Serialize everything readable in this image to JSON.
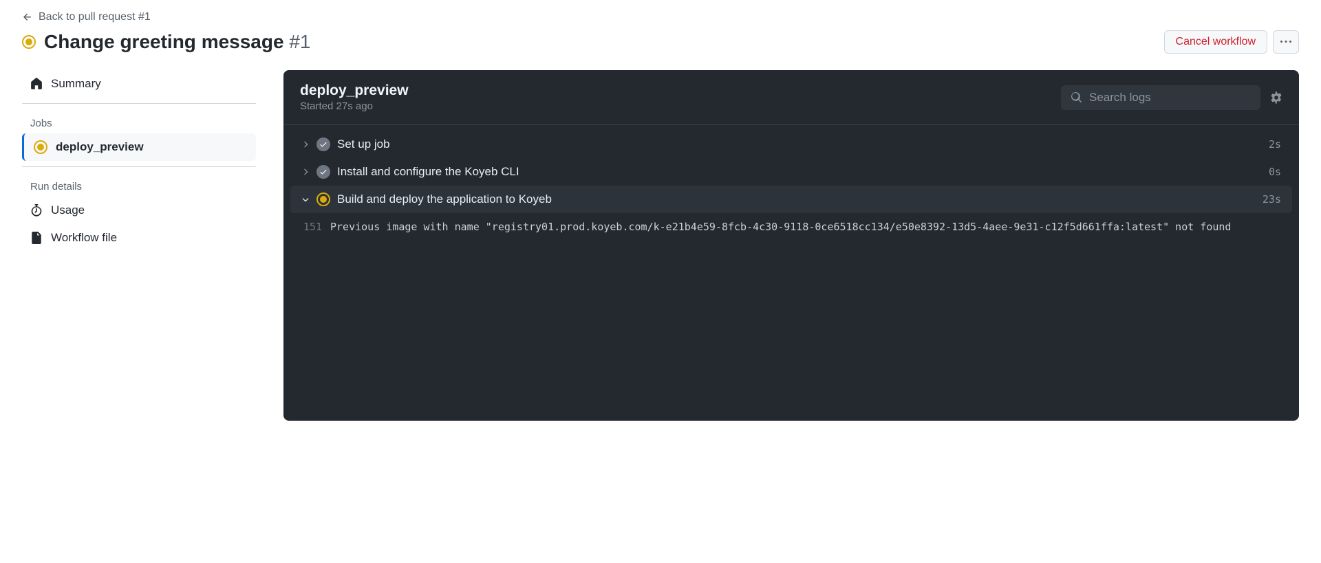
{
  "back_link": "Back to pull request #1",
  "title": "Change greeting message",
  "title_num": "#1",
  "actions": {
    "cancel": "Cancel workflow"
  },
  "sidebar": {
    "summary": "Summary",
    "jobs_label": "Jobs",
    "job_name": "deploy_preview",
    "run_details_label": "Run details",
    "usage": "Usage",
    "workflow_file": "Workflow file"
  },
  "main": {
    "title": "deploy_preview",
    "started": "Started 27s ago",
    "search_placeholder": "Search logs"
  },
  "steps": [
    {
      "name": "Set up job",
      "time": "2s",
      "status": "done",
      "expanded": false
    },
    {
      "name": "Install and configure the Koyeb CLI",
      "time": "0s",
      "status": "done",
      "expanded": false
    },
    {
      "name": "Build and deploy the application to Koyeb",
      "time": "23s",
      "status": "running",
      "expanded": true
    }
  ],
  "logs": [
    {
      "n": "151",
      "t": "Previous image with name \"registry01.prod.koyeb.com/k-e21b4e59-8fcb-4c30-9118-0ce6518cc134/e50e8392-13d5-4aee-9e31-c12f5d661ffa:latest\" not found"
    }
  ]
}
